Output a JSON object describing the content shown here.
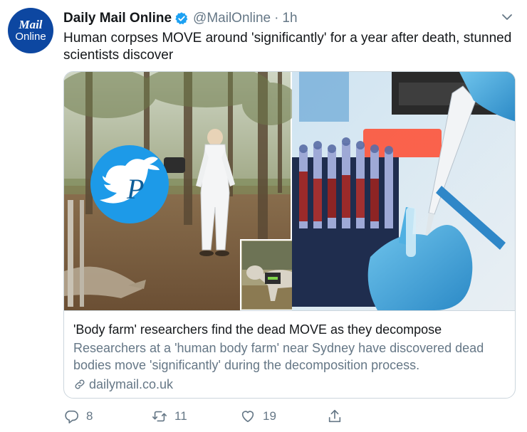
{
  "account": {
    "avatar_line1": "Mail",
    "avatar_line2": "Online",
    "name": "Daily Mail Online",
    "handle": "@MailOnline",
    "separator": "·",
    "time": "1h"
  },
  "tweet": {
    "text": "Human corpses MOVE around 'significantly' for a year after death, stunned scientists discover"
  },
  "card": {
    "title": "'Body farm' researchers find the dead MOVE as they decompose",
    "description": "Researchers at a 'human body farm' near Sydney have discovered dead bodies move 'significantly' during the decomposition process.",
    "domain": "dailymail.co.uk"
  },
  "actions": {
    "replies": "8",
    "retweets": "11",
    "likes": "19"
  },
  "colors": {
    "brand_blue": "#1da1f2",
    "text_primary": "#14171a",
    "text_secondary": "#657786",
    "border": "#ccd6dd",
    "avatar_bg": "#0d47a1"
  },
  "icons": [
    "verified-badge-icon",
    "chevron-down-icon",
    "link-icon",
    "reply-icon",
    "retweet-icon",
    "like-icon",
    "share-icon",
    "twitter-bird-watermark-icon"
  ]
}
